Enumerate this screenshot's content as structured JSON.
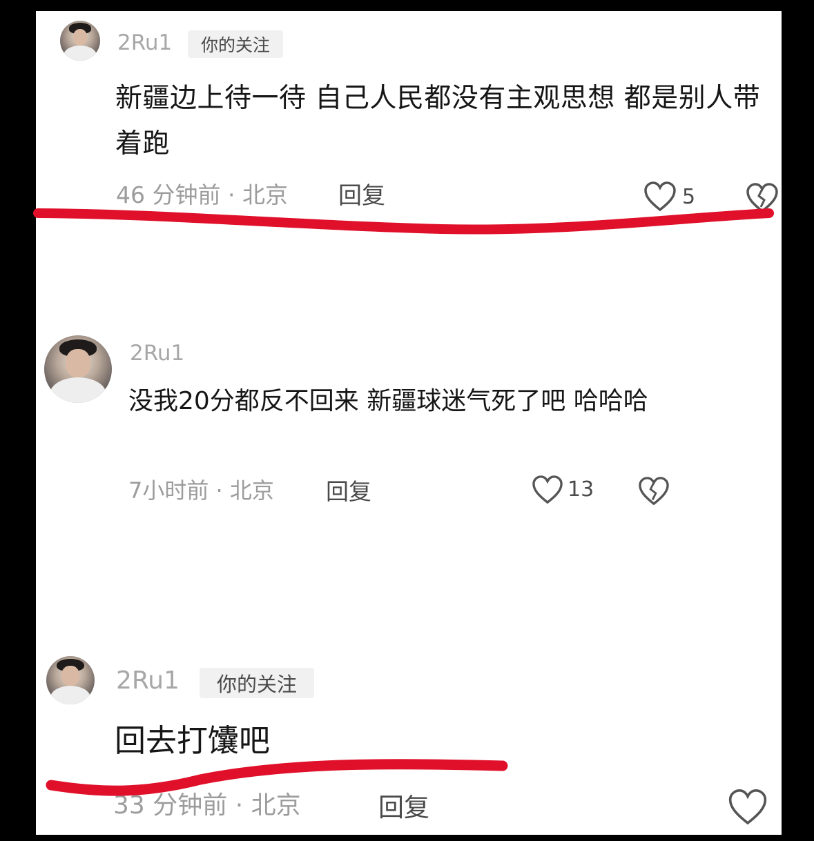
{
  "comments": [
    {
      "username": "2Ru1",
      "badge": "你的关注",
      "text": "新疆边上待一待 自己人民都没有主观思想 都是别人带着跑",
      "time_location": "46 分钟前 · 北京",
      "reply_label": "回复",
      "like_count": "5"
    },
    {
      "username": "2Ru1",
      "text": "没我20分都反不回来 新疆球迷气死了吧 哈哈哈",
      "time_location": "7小时前 · 北京",
      "reply_label": "回复",
      "like_count": "13"
    },
    {
      "username": "2Ru1",
      "badge": "你的关注",
      "text": "回去打馕吧",
      "time_location": "33 分钟前 · 北京",
      "reply_label": "回复"
    }
  ],
  "icons": {
    "like": "heart-outline-icon",
    "dislike": "broken-heart-icon"
  },
  "colors": {
    "underline": "#e0102a",
    "username": "#a7a7a7",
    "meta": "#9c9c9c",
    "text": "#161616"
  }
}
